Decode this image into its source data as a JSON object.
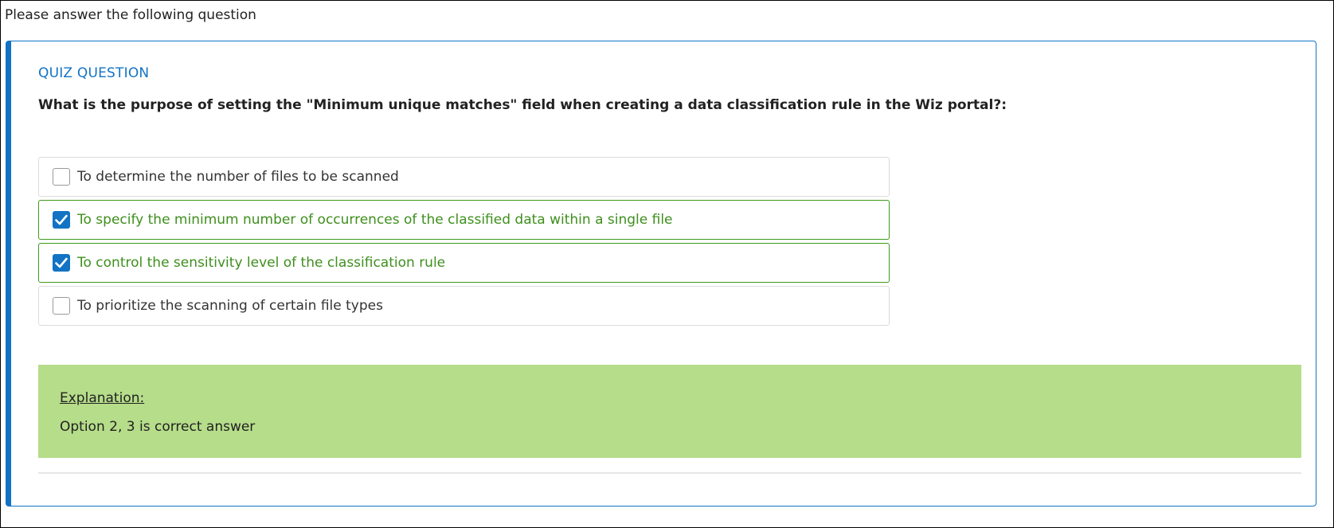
{
  "prompt": "Please answer the following question",
  "quiz": {
    "label": "QUIZ QUESTION",
    "question": "What is the purpose of setting the \"Minimum unique matches\" field when creating a data classification rule in the Wiz portal?:",
    "options": [
      {
        "text": "To determine the number of files to be scanned",
        "checked": false,
        "correct": false
      },
      {
        "text": "To specify the minimum number of occurrences of the classified data within a single file",
        "checked": true,
        "correct": true
      },
      {
        "text": "To control the sensitivity level of the classification rule",
        "checked": true,
        "correct": true
      },
      {
        "text": "To prioritize the scanning of certain file types",
        "checked": false,
        "correct": false
      }
    ],
    "explanation": {
      "title": "Explanation:",
      "text": "Option 2, 3 is correct answer"
    }
  },
  "colors": {
    "accent": "#1273c4",
    "correct_border": "#3e9a1d",
    "correct_text": "#3e8f1d",
    "explanation_bg": "#b6dd8a"
  },
  "icons": {
    "checked": "check-icon"
  }
}
